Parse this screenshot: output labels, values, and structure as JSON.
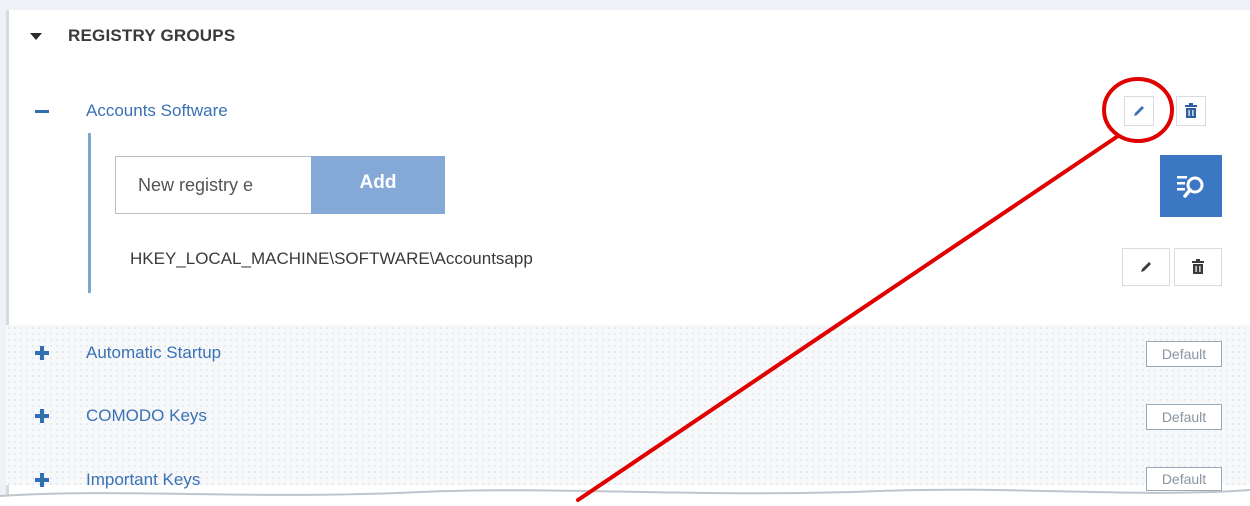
{
  "section": {
    "title": "REGISTRY GROUPS",
    "caret_icon": "caret-down-icon"
  },
  "groups": [
    {
      "name": "Accounts Software",
      "expanded": true,
      "toggle_icon": "minus-icon"
    },
    {
      "name": "Automatic Startup",
      "expanded": false,
      "toggle_icon": "plus-icon",
      "badge": "Default"
    },
    {
      "name": "COMODO Keys",
      "expanded": false,
      "toggle_icon": "plus-icon",
      "badge": "Default"
    },
    {
      "name": "Important Keys",
      "expanded": false,
      "toggle_icon": "plus-icon",
      "badge": "Default"
    }
  ],
  "editor": {
    "input_value": "New registry e",
    "add_label": "Add",
    "search_icon": "search-list-icon",
    "entry_path": "HKEY_LOCAL_MACHINE\\SOFTWARE\\Accountsapp"
  },
  "icons": {
    "edit": "pencil-icon",
    "delete": "trash-icon"
  },
  "colors": {
    "link_blue": "#3a72b4",
    "accent_blue": "#3b77c2",
    "add_button": "#84a9d6",
    "annotation_red": "#e00000"
  }
}
